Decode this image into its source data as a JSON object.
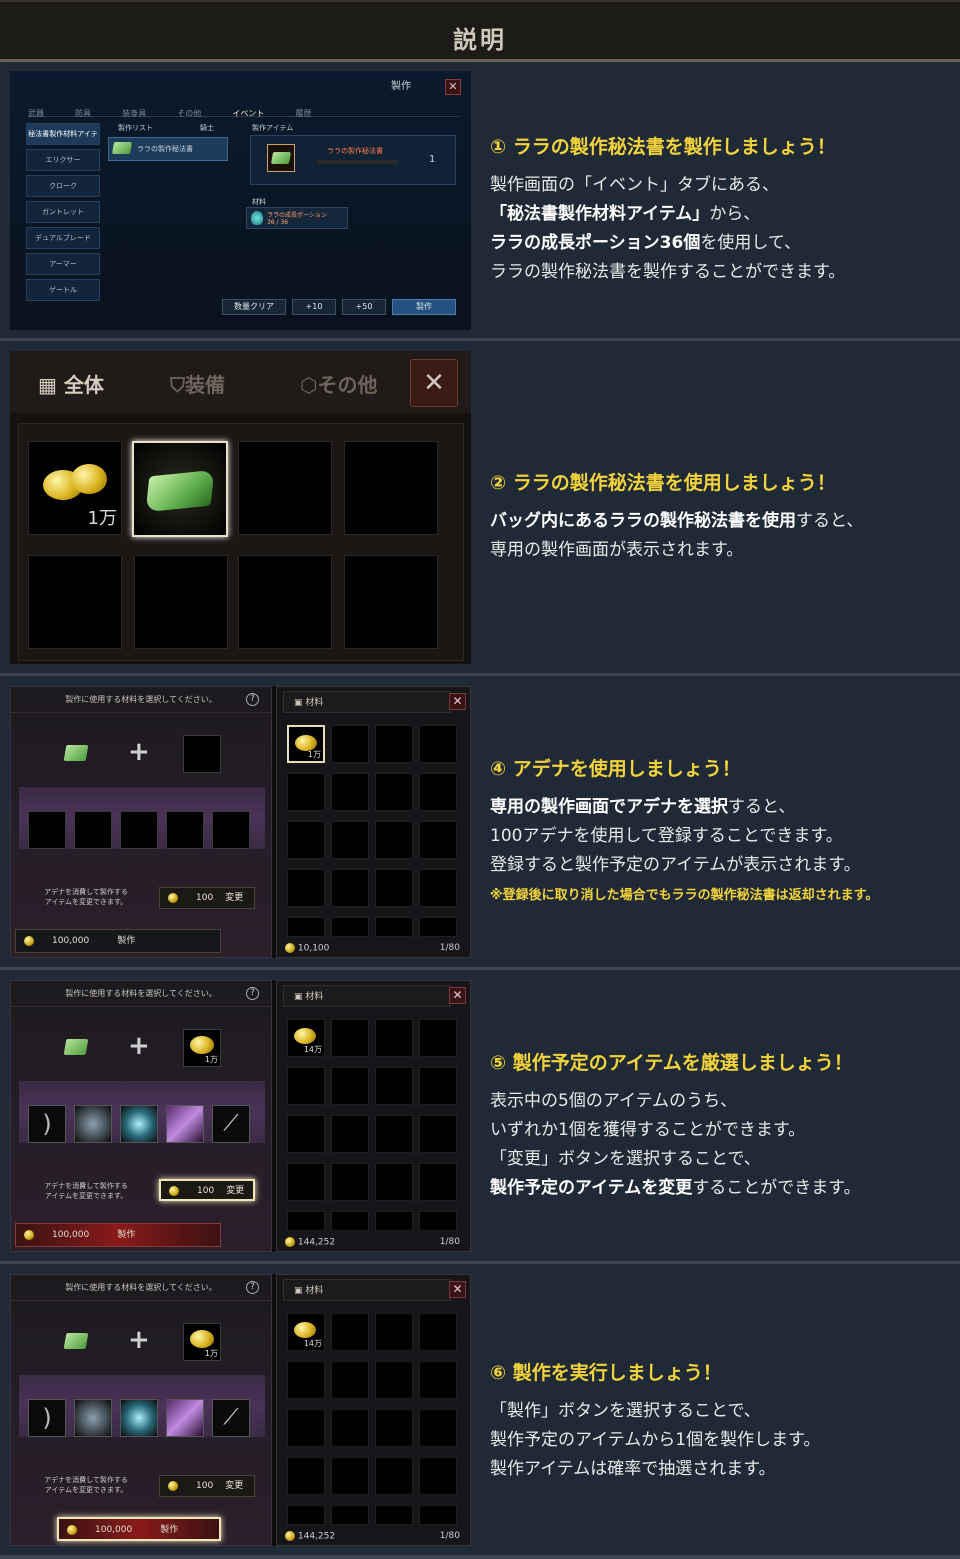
{
  "header": {
    "title": "説明"
  },
  "s1": {
    "window_title": "製作",
    "tabs": [
      "武器",
      "防具",
      "装身具",
      "その他",
      "イベント",
      "履歴"
    ],
    "sidebar": [
      "秘法書製作材料アイテム",
      "エリクサー",
      "クローク",
      "ガントレット",
      "デュアルブレード",
      "アーマー",
      "ゲートル"
    ],
    "list_label": "製作リスト",
    "class_label": "騎士",
    "list_item": "ララの製作秘法書",
    "craft_item_label": "製作アイテム",
    "craft_item_name": "ララの製作秘法書",
    "craft_qty": "1",
    "material_label": "材料",
    "material_name": "ララの成長ポーション",
    "material_count": "36 / 36",
    "btn_clear": "数量クリア",
    "btn_10": "+10",
    "btn_50": "+50",
    "btn_craft": "製作",
    "step": "① ララの製作秘法書を製作しましょう！",
    "l1": "製作画面の「イベント」タブにある、",
    "l2b": "「秘法書製作材料アイテム」",
    "l2": "から、",
    "l3b": "ララの成長ポーション36個",
    "l3": "を使用して、",
    "l4": "ララの製作秘法書を製作することができます。"
  },
  "s2": {
    "tab_all": "全体",
    "tab_equip": "装備",
    "tab_other": "その他",
    "close": "✕",
    "coin_qty": "1万",
    "step": "② ララの製作秘法書を使用しましょう！",
    "l1b": "バッグ内にあるララの製作秘法書を使用",
    "l1": "すると、",
    "l2": "専用の製作画面が表示されます。"
  },
  "craft_common": {
    "prompt": "製作に使用する材料を選択してください。",
    "help": "?",
    "desc1": "アデナを消費して製作する",
    "desc2": "アイテムを変更できます。",
    "cost": "100",
    "change": "変更",
    "craft": "製作",
    "adena": "100,000",
    "material": "材料",
    "close": "✕",
    "cap": "1/80"
  },
  "s4": {
    "bag_coin": "1万",
    "gold": "10,100",
    "step": "④ アデナを使用しましょう！",
    "l1b": "専用の製作画面でアデナを選択",
    "l1": "すると、",
    "l2": "100アデナを使用して登録することできます。",
    "l3": "登録すると製作予定のアイテムが表示されます。",
    "note": "※登録後に取り消した場合でもララの製作秘法書は返却されます。"
  },
  "s5": {
    "slot_coin": "1万",
    "bag_coin": "14万",
    "gold": "144,252",
    "step": "⑤ 製作予定のアイテムを厳選しましょう！",
    "l1": "表示中の5個のアイテムのうち、",
    "l2": "いずれか1個を獲得することができます。",
    "l3": "「変更」ボタンを選択することで、",
    "l4b": "製作予定のアイテムを変更",
    "l4": "することができます。"
  },
  "s6": {
    "slot_coin": "1万",
    "bag_coin": "14万",
    "gold": "144,252",
    "step": "⑥ 製作を実行しましょう！",
    "l1": "「製作」ボタンを選択することで、",
    "l2": "製作予定のアイテムから1個を製作します。",
    "l3": "製作アイテムは確率で抽選されます。"
  }
}
